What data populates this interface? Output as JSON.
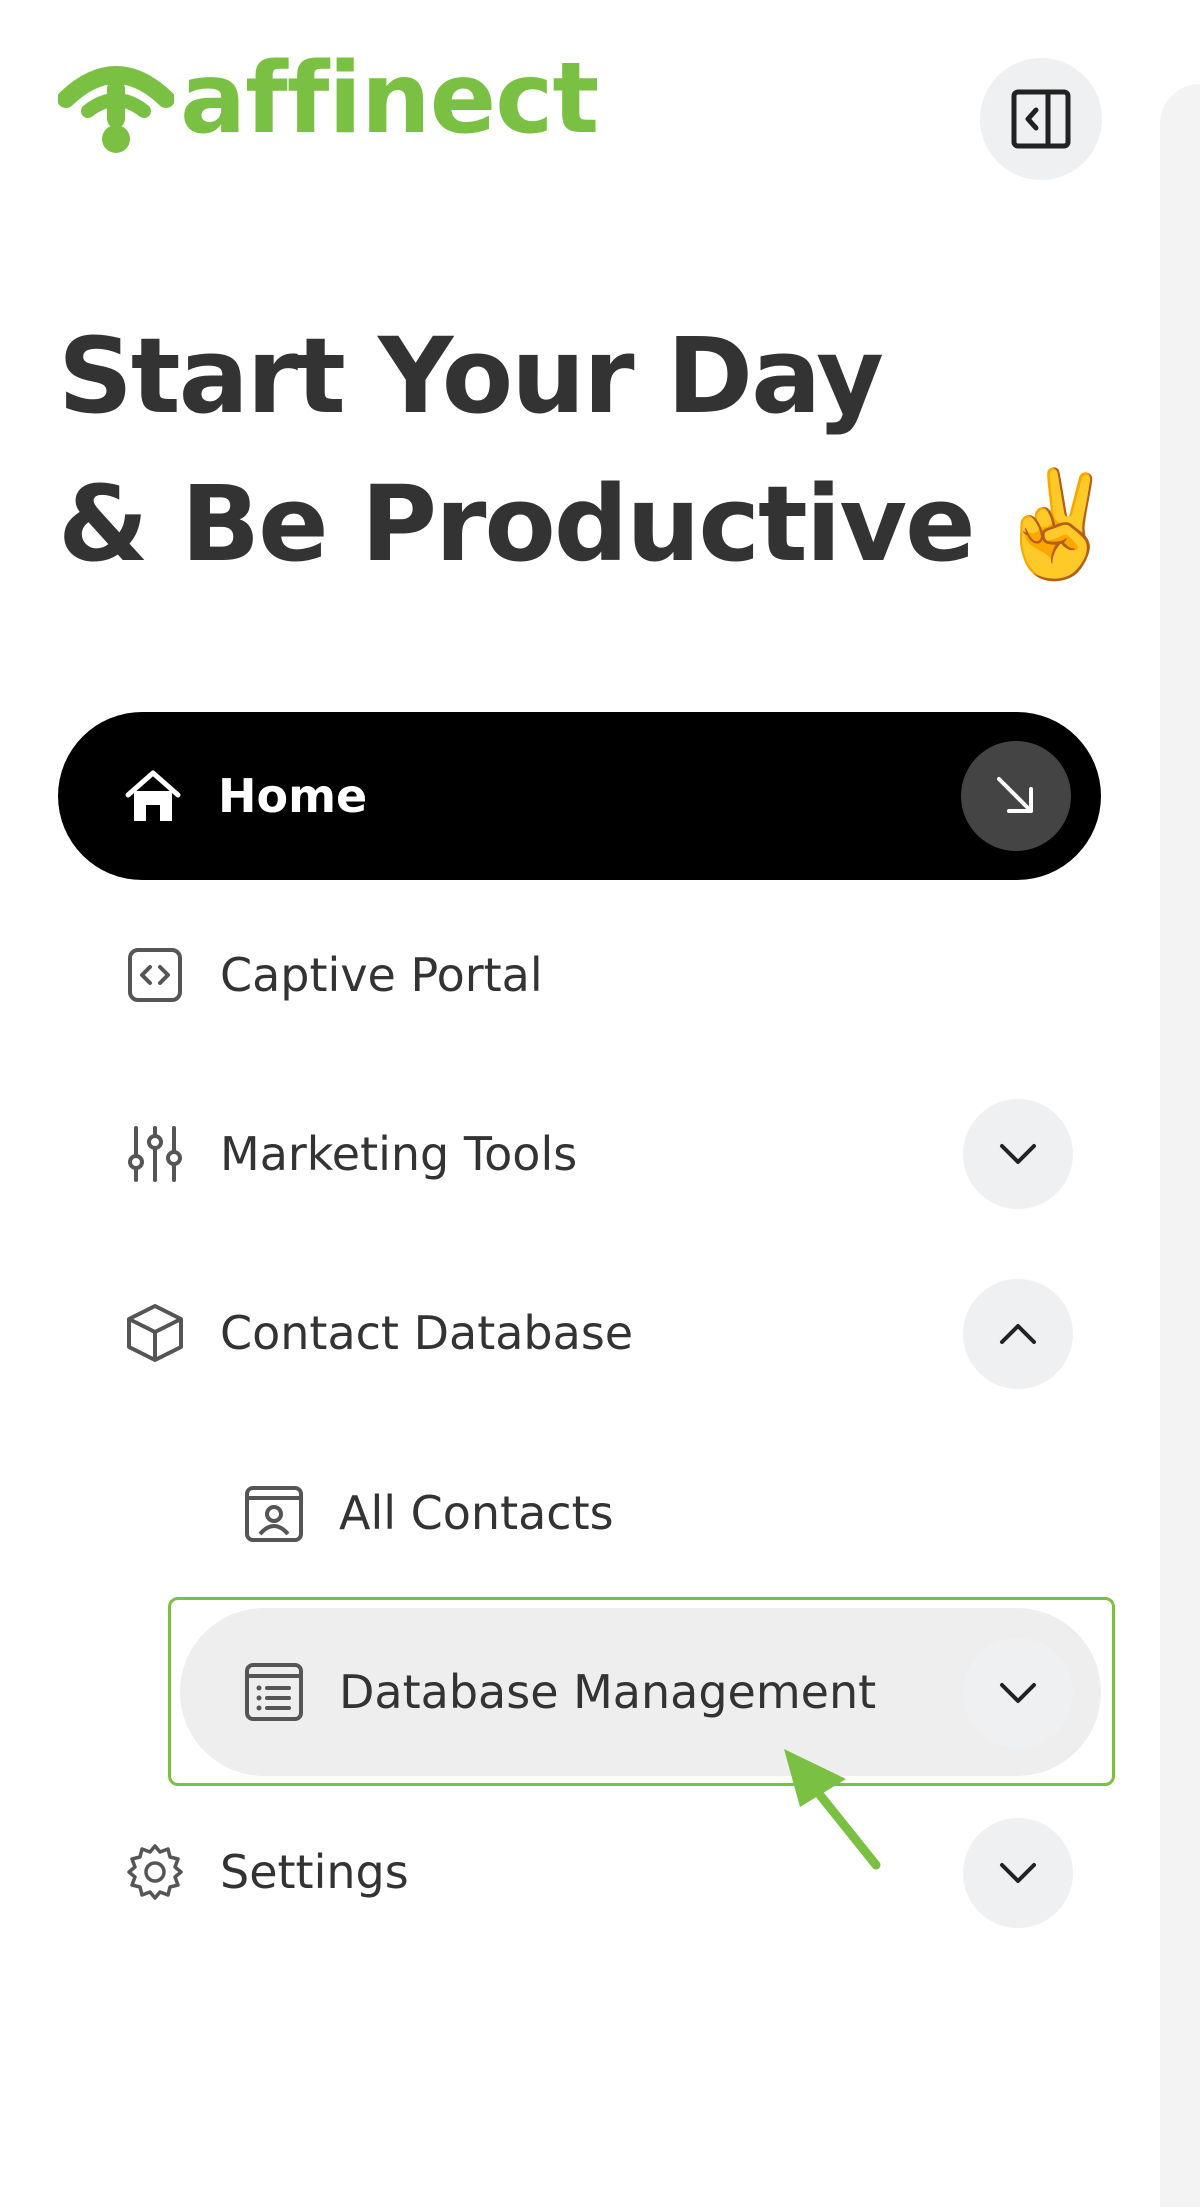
{
  "brand": {
    "name": "affinect",
    "color": "#7ac143"
  },
  "headline": {
    "line1": "Start Your Day",
    "line2": "& Be Productive",
    "emoji": "✌️"
  },
  "nav": {
    "home": {
      "label": "Home",
      "icon": "home-icon",
      "active": true
    },
    "captive_portal": {
      "label": "Captive Portal",
      "icon": "code-icon"
    },
    "marketing_tools": {
      "label": "Marketing Tools",
      "icon": "sliders-icon",
      "expanded": false
    },
    "contact_database": {
      "label": "Contact Database",
      "icon": "cube-icon",
      "expanded": true,
      "children": {
        "all_contacts": {
          "label": "All Contacts",
          "icon": "contact-card-icon"
        },
        "database_management": {
          "label": "Database Management",
          "icon": "list-icon",
          "expanded": false,
          "highlighted": true
        }
      }
    },
    "settings": {
      "label": "Settings",
      "icon": "gear-icon",
      "expanded": false
    }
  },
  "colors": {
    "active_bg": "#000000",
    "text": "#333333",
    "accent": "#7ac143",
    "chevron_bg": "#eef0f2"
  }
}
